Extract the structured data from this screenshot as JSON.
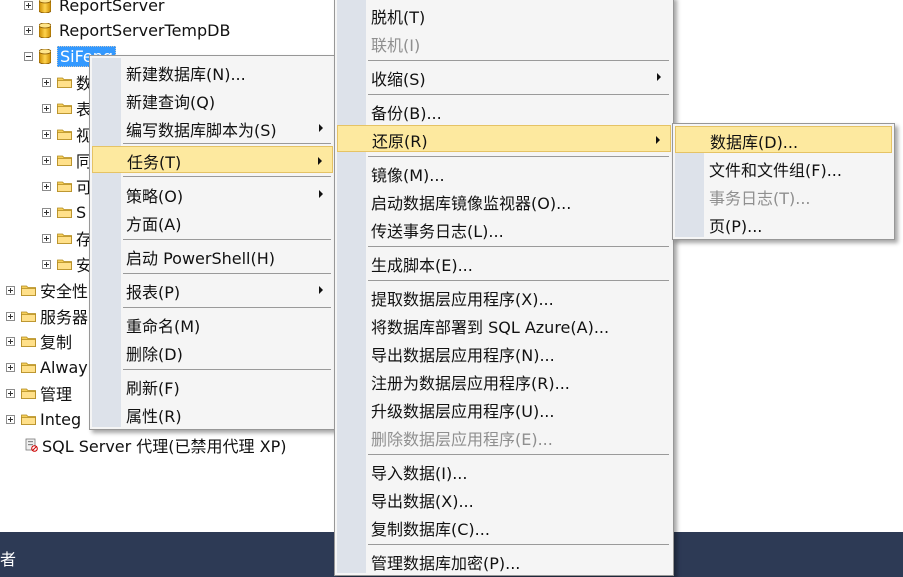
{
  "tree": {
    "report_server": "ReportServer",
    "report_server_temp": "ReportServerTempDB",
    "sifeng": "SiFeng",
    "children": [
      "数",
      "表",
      "视",
      "同",
      "可",
      "S",
      "存",
      "安"
    ],
    "top_nodes": [
      "安全性",
      "服务器",
      "复制",
      "Alway",
      "管理",
      "Integ"
    ],
    "agent": "SQL Server 代理(已禁用代理 XP)"
  },
  "statusbar": {
    "text": "者"
  },
  "context_menu": {
    "items": [
      {
        "label": "新建数据库(N)..."
      },
      {
        "label": "新建查询(Q)"
      },
      {
        "label": "编写数据库脚本为(S)"
      },
      {
        "label": "任务(T)"
      },
      {
        "label": "策略(O)"
      },
      {
        "label": "方面(A)"
      },
      {
        "label": "启动 PowerShell(H)"
      },
      {
        "label": "报表(P)"
      },
      {
        "label": "重命名(M)"
      },
      {
        "label": "删除(D)"
      },
      {
        "label": "刷新(F)"
      },
      {
        "label": "属性(R)"
      }
    ]
  },
  "tasks_menu": {
    "items": [
      {
        "label": "脱机(T)"
      },
      {
        "label": "联机(I)"
      },
      {
        "label": "收缩(S)"
      },
      {
        "label": "备份(B)..."
      },
      {
        "label": "还原(R)"
      },
      {
        "label": "镜像(M)..."
      },
      {
        "label": "启动数据库镜像监视器(O)..."
      },
      {
        "label": "传送事务日志(L)..."
      },
      {
        "label": "生成脚本(E)..."
      },
      {
        "label": "提取数据层应用程序(X)..."
      },
      {
        "label": "将数据库部署到 SQL Azure(A)..."
      },
      {
        "label": "导出数据层应用程序(N)..."
      },
      {
        "label": "注册为数据层应用程序(R)..."
      },
      {
        "label": "升级数据层应用程序(U)..."
      },
      {
        "label": "删除数据层应用程序(E)..."
      },
      {
        "label": "导入数据(I)..."
      },
      {
        "label": "导出数据(X)..."
      },
      {
        "label": "复制数据库(C)..."
      },
      {
        "label": "管理数据库加密(P)..."
      }
    ]
  },
  "restore_menu": {
    "items": [
      {
        "label": "数据库(D)..."
      },
      {
        "label": "文件和文件组(F)..."
      },
      {
        "label": "事务日志(T)..."
      },
      {
        "label": "页(P)..."
      }
    ]
  },
  "colors": {
    "highlight": "#fde99f",
    "selection": "#3399ff",
    "statusbar": "#2d3a55",
    "menu_bg": "#f5f5f5",
    "gutter": "#dde2ea"
  }
}
